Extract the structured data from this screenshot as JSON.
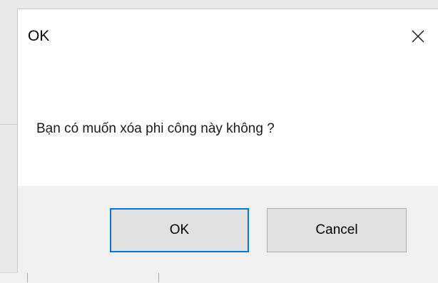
{
  "dialog": {
    "title": "OK",
    "message": "Bạn có muốn xóa phi công này không ?",
    "close_icon": "close-icon",
    "buttons": {
      "ok_label": "OK",
      "cancel_label": "Cancel"
    },
    "colors": {
      "focus_border": "#0078d7",
      "footer_background": "#f0f0f0",
      "button_background": "#e1e1e1"
    }
  }
}
